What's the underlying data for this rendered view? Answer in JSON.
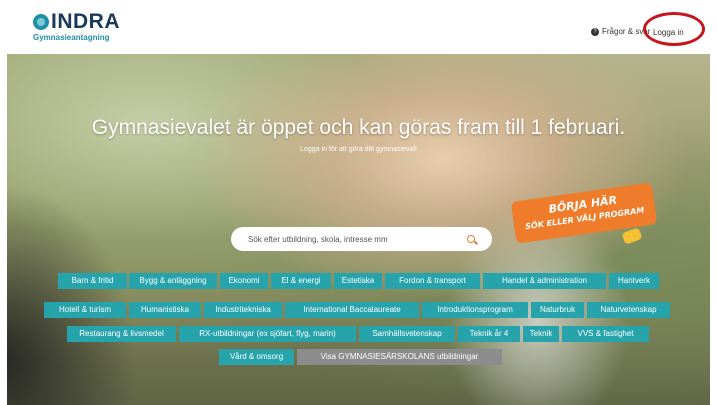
{
  "header": {
    "logo_text": "INDRA",
    "logo_sub": "Gymnasieantagning",
    "faq_label": "Frågor & svar",
    "login_label": "Logga in"
  },
  "hero": {
    "headline": "Gymnasievalet är öppet och kan göras fram till 1 februari.",
    "subline": "Logga in för att göra ditt gymnasieval!",
    "badge_line1": "BÖRJA HÄR",
    "badge_line2": "SÖK ELLER VÄLJ PROGRAM"
  },
  "search": {
    "placeholder": "Sök efter utbildning, skola, intresse mm",
    "icon": "search-icon"
  },
  "programs": [
    "Barn & fritid",
    "Bygg & anläggning",
    "Ekonomi",
    "El & energi",
    "Estetiska",
    "Fordon & transport",
    "Handel & administration",
    "Hantverk",
    "Hotell & turism",
    "Humanistiska",
    "Industritekniska",
    "International Baccalaureate",
    "Introduktionsprogram",
    "Naturbruk",
    "Naturvetenskap",
    "Restaurang & livsmedel",
    "RX-utbildningar (ex sjöfart, flyg, marin)",
    "Samhällsvetenskap",
    "Teknik år 4",
    "Teknik",
    "VVS & fastighet",
    "Vård & omsorg"
  ],
  "special_programs_label": "Visa GYMNASIESÄRSKOLANS utbildningar",
  "colors": {
    "tag": "#26a3ab",
    "tag_special": "#8c8c8c",
    "badge": "#ee7c2a",
    "login_highlight": "#c4161c"
  }
}
